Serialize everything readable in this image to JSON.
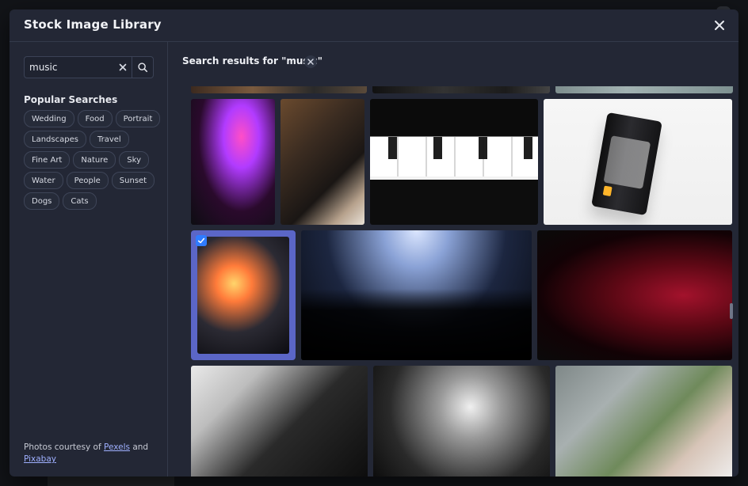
{
  "modal": {
    "title": "Stock Image Library"
  },
  "search": {
    "value": "music",
    "placeholder": ""
  },
  "popular": {
    "title": "Popular Searches",
    "items": [
      "Wedding",
      "Food",
      "Portrait",
      "Landscapes",
      "Travel",
      "Fine Art",
      "Nature",
      "Sky",
      "Water",
      "People",
      "Sunset",
      "Dogs",
      "Cats"
    ]
  },
  "results": {
    "title": "Search results for \"music\""
  },
  "attribution": {
    "prefix": "Photos courtesy of ",
    "pexels": "Pexels",
    "middle": " and",
    "pixabay": "Pixabay"
  },
  "icons": {
    "close": "close-icon",
    "search": "search-icon",
    "clear": "clear-icon",
    "check": "check-icon"
  },
  "colors": {
    "accent": "#5b66c7",
    "link": "#9fb0ff"
  }
}
